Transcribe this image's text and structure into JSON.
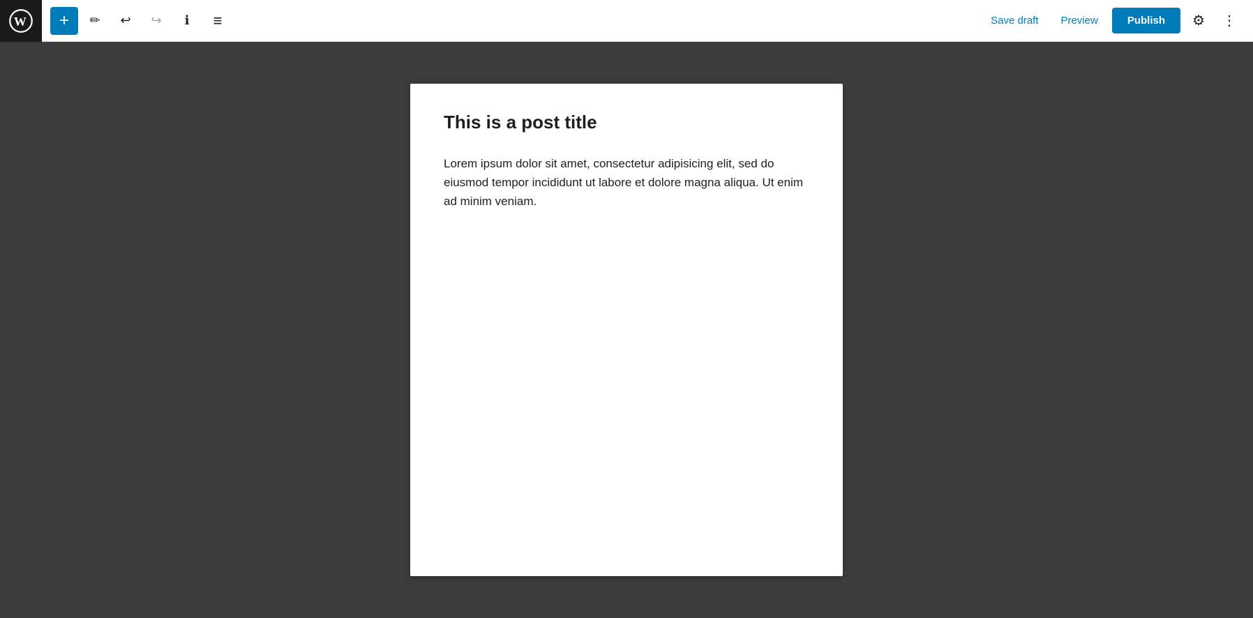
{
  "toolbar": {
    "wp_logo_label": "WordPress",
    "add_block_label": "+",
    "tools_label": "✏",
    "undo_label": "↩",
    "redo_label": "↪",
    "info_label": "ℹ",
    "list_view_label": "≡",
    "save_draft_label": "Save draft",
    "preview_label": "Preview",
    "publish_label": "Publish",
    "settings_label": "⚙",
    "more_label": "⋮"
  },
  "editor": {
    "post_title": "This is a post title",
    "post_body": "Lorem ipsum dolor sit amet, consectetur adipisicing elit, sed do eiusmod tempor incididunt ut labore et dolore magna aliqua. Ut enim ad minim veniam."
  },
  "colors": {
    "wp_blue": "#007cba",
    "toolbar_bg": "#ffffff",
    "logo_bg": "#1a1a1a",
    "canvas_bg": "#ffffff",
    "editor_bg": "#3c3c3c"
  }
}
